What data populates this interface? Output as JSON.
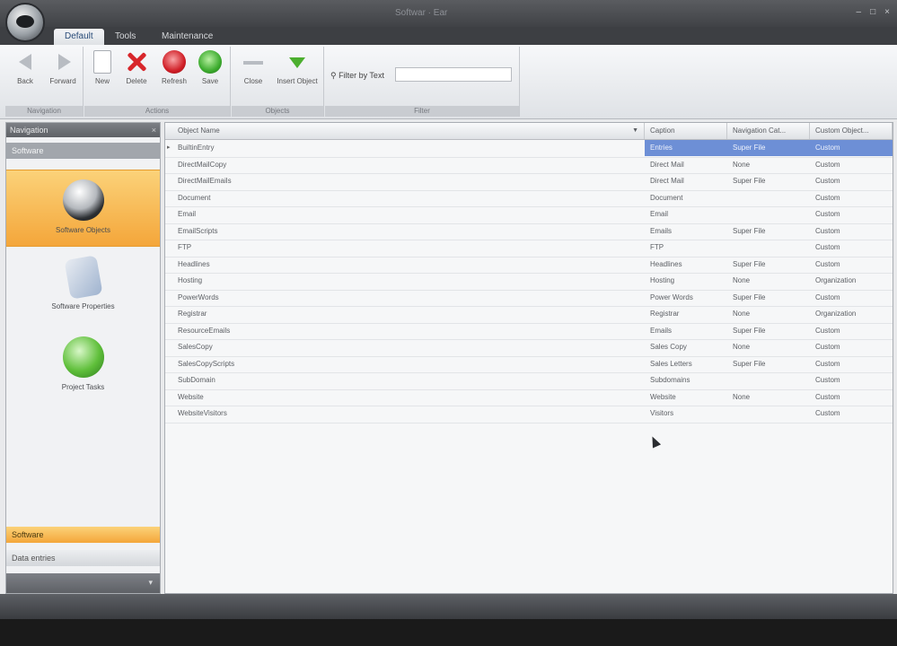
{
  "app": {
    "title": "Softwar · Ear"
  },
  "window_controls": [
    "–",
    "□",
    "×"
  ],
  "ribbon": {
    "tabs": [
      {
        "label": "Default",
        "active": true
      },
      {
        "label": "Tools",
        "active": false
      },
      {
        "label": "Maintenance",
        "active": false
      }
    ],
    "groups": [
      {
        "label": "Navigation",
        "buttons": [
          "Back",
          "Forward"
        ]
      },
      {
        "label": "Actions",
        "buttons": [
          "New",
          "Delete",
          "Refresh",
          "Save"
        ]
      },
      {
        "label": "Objects",
        "buttons": [
          "Close",
          "Insert Object"
        ]
      },
      {
        "label": "Filter"
      }
    ],
    "filter": {
      "label": "Filter by Text",
      "value": ""
    }
  },
  "nav": {
    "header": "Navigation",
    "pin": "×",
    "subheader": "Software",
    "items": [
      {
        "label": "Software Objects",
        "icon": "globe-icon",
        "selected": true
      },
      {
        "label": "Software Properties",
        "icon": "properties-icon",
        "selected": false
      },
      {
        "label": "Project Tasks",
        "icon": "tasks-icon",
        "selected": false
      }
    ],
    "bottom_buttons": [
      {
        "label": "Software",
        "active": true
      },
      {
        "label": "Data entries",
        "active": false
      }
    ],
    "footer_arrow": "▾"
  },
  "grid": {
    "columns": [
      "Object Name",
      "Caption",
      "Navigation Cat...",
      "Custom Object..."
    ],
    "sort_indicator": "▼",
    "rows": [
      {
        "name": "BuiltinEntry",
        "caption": "Entries",
        "nav": "Super File",
        "custom": "Custom",
        "selected": true
      },
      {
        "name": "DirectMailCopy",
        "caption": "Direct Mail",
        "nav": "None",
        "custom": "Custom"
      },
      {
        "name": "DirectMailEmails",
        "caption": "Direct Mail",
        "nav": "Super File",
        "custom": "Custom"
      },
      {
        "name": "Document",
        "caption": "Document",
        "nav": "",
        "custom": "Custom"
      },
      {
        "name": "Email",
        "caption": "Email",
        "nav": "",
        "custom": "Custom"
      },
      {
        "name": "EmailScripts",
        "caption": "Emails",
        "nav": "Super File",
        "custom": "Custom"
      },
      {
        "name": "FTP",
        "caption": "FTP",
        "nav": "",
        "custom": "Custom"
      },
      {
        "name": "Headlines",
        "caption": "Headlines",
        "nav": "Super File",
        "custom": "Custom"
      },
      {
        "name": "Hosting",
        "caption": "Hosting",
        "nav": "None",
        "custom": "Organization"
      },
      {
        "name": "PowerWords",
        "caption": "Power Words",
        "nav": "Super File",
        "custom": "Custom"
      },
      {
        "name": "Registrar",
        "caption": "Registrar",
        "nav": "None",
        "custom": "Organization"
      },
      {
        "name": "ResourceEmails",
        "caption": "Emails",
        "nav": "Super File",
        "custom": "Custom"
      },
      {
        "name": "SalesCopy",
        "caption": "Sales Copy",
        "nav": "None",
        "custom": "Custom"
      },
      {
        "name": "SalesCopyScripts",
        "caption": "Sales Letters",
        "nav": "Super File",
        "custom": "Custom"
      },
      {
        "name": "SubDomain",
        "caption": "Subdomains",
        "nav": "",
        "custom": "Custom"
      },
      {
        "name": "Website",
        "caption": "Website",
        "nav": "None",
        "custom": "Custom"
      },
      {
        "name": "WebsiteVisitors",
        "caption": "Visitors",
        "nav": "",
        "custom": "Custom"
      }
    ]
  },
  "colors": {
    "selected_row": "#6d8fd6",
    "nav_selected": "#f4a63a",
    "chrome_dark": "#404246"
  }
}
